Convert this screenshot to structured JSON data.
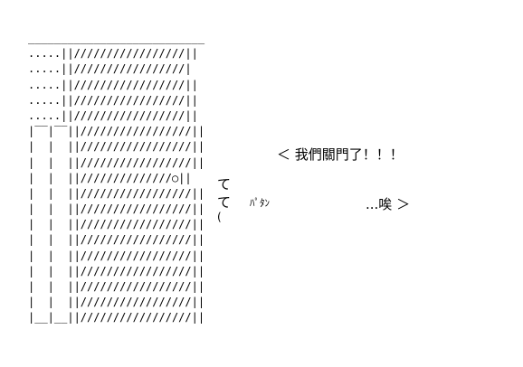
{
  "ascii_art": {
    "lines": [
      "___________________________",
      ".....||/////////////////||",
      ".....||/////////////////|",
      ".....||/////////////////||",
      ".....||/////////////////||",
      ".....||/////////////////||",
      "|‾‾|‾‾||/////////////////||",
      "|  |  ||/////////////////||",
      "|  |  ||/////////////////||",
      "|  |  ||//////////////○||",
      "|  |  ||/////////////////||",
      "|  |  ||/////////////////||",
      "|  |  ||/////////////////||",
      "|  |  ||/////////////////||",
      "|  |  ||/////////////////||",
      "|  |  ||/////////////////||",
      "|  |  ||/////////////////||",
      "|  |  ||/////////////////||",
      "|__|__||/////////////////||"
    ]
  },
  "dialogue": {
    "shout": "＜ 我們關門了！！！",
    "te_1": "て",
    "te_2": "て",
    "paren": "(",
    "sound_effect": "ﾊﾟﾀﾝ",
    "sigh": "...唉 ＞"
  }
}
